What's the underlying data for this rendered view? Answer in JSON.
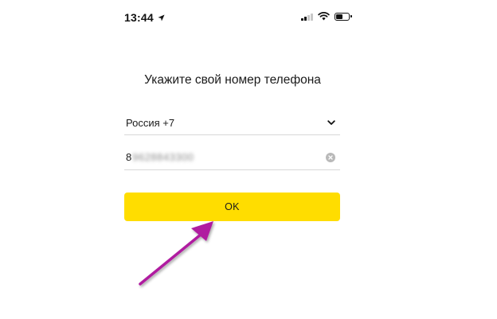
{
  "status_bar": {
    "time": "13:44",
    "icons": [
      "location-arrow",
      "cellular-signal",
      "wifi",
      "battery"
    ]
  },
  "page": {
    "title": "Укажите свой номер телефона"
  },
  "country_select": {
    "label": "Россия +7",
    "icon": "chevron-down"
  },
  "phone_field": {
    "prefix": "8",
    "blurred_value": "9628843300",
    "clear_icon": "clear-circle-x"
  },
  "ok_button": {
    "label": "OK",
    "color": "#ffdd00"
  },
  "annotation": {
    "arrow_color": "#b01ea0"
  }
}
